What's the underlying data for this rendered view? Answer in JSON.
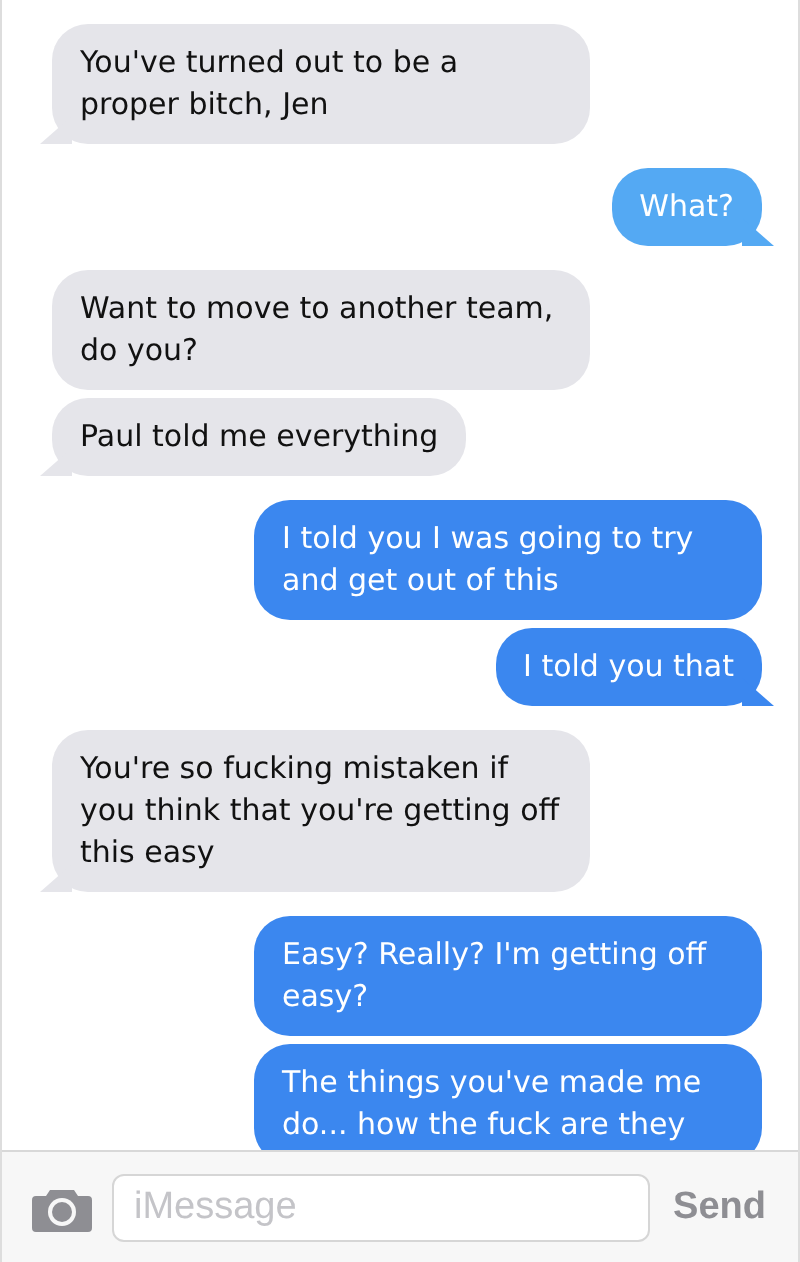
{
  "messages": [
    {
      "kind": "received",
      "text": "You've turned out to be a proper bitch, Jen",
      "tail": true,
      "color": "#e5e5ea"
    },
    {
      "kind": "sent",
      "text": "What?",
      "tail": true,
      "color": "#54a9f3"
    },
    {
      "kind": "received",
      "text": "Want to move to another team, do you?",
      "tail": false,
      "color": "#e5e5ea"
    },
    {
      "kind": "received",
      "text": "Paul told me everything",
      "tail": true,
      "color": "#e5e5ea"
    },
    {
      "kind": "sent",
      "text": "I told you I was going to try and get out of this",
      "tail": false,
      "color": "#3b87ef"
    },
    {
      "kind": "sent",
      "text": "I told you that",
      "tail": true,
      "color": "#3b87ef"
    },
    {
      "kind": "received",
      "text": "You're so fucking mistaken if you think that you're getting off this easy",
      "tail": true,
      "color": "#e5e5ea"
    },
    {
      "kind": "sent",
      "text": "Easy? Really? I'm getting off easy?",
      "tail": false,
      "color": "#3b87ef"
    },
    {
      "kind": "sent",
      "text": "The things you've made me do... how the fuck are they",
      "tail": false,
      "color": "#3b87ef"
    }
  ],
  "compose": {
    "placeholder": "iMessage",
    "send": "Send"
  }
}
